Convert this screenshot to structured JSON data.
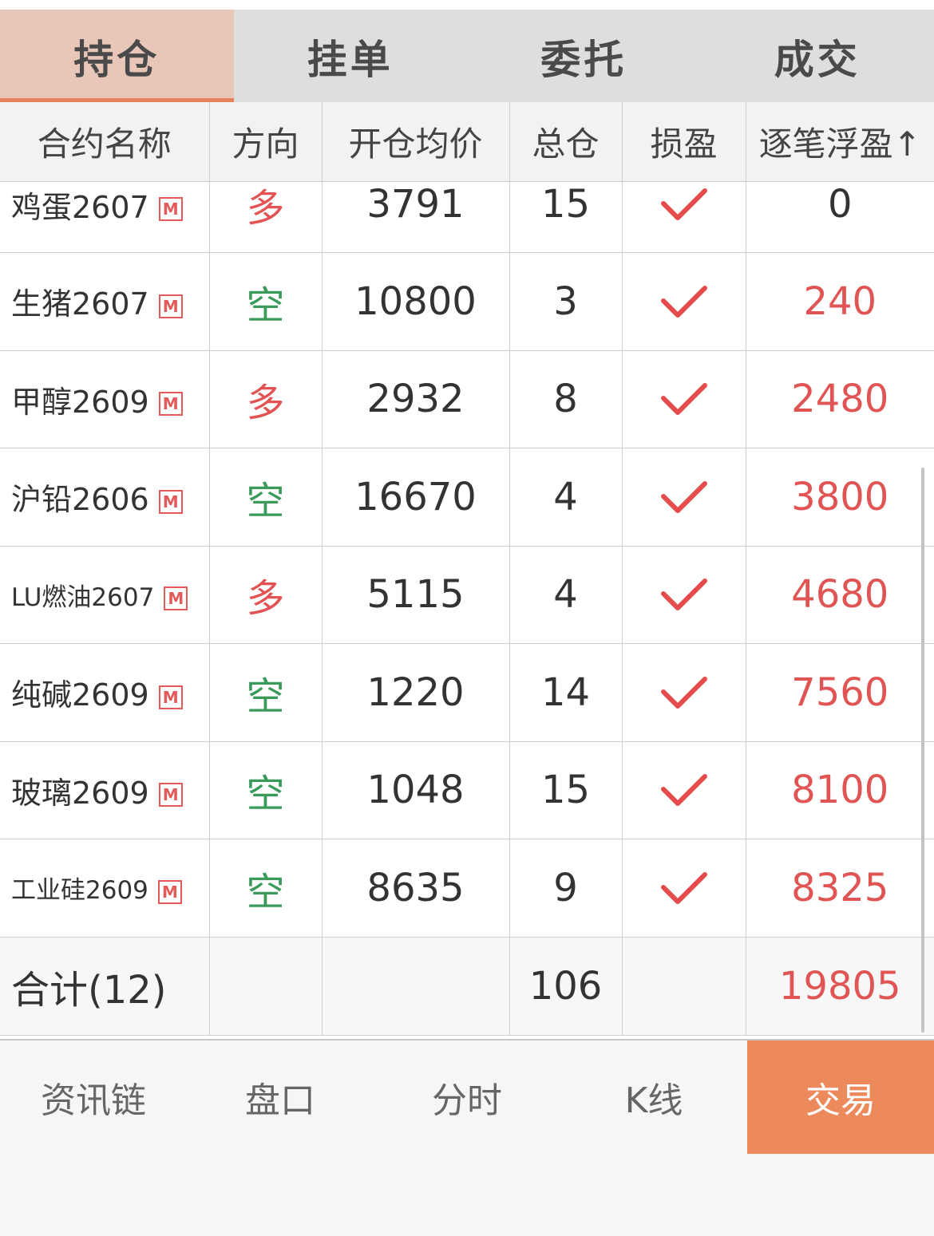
{
  "tabs": [
    {
      "label": "持仓",
      "active": true
    },
    {
      "label": "挂单",
      "active": false
    },
    {
      "label": "委托",
      "active": false
    },
    {
      "label": "成交",
      "active": false
    }
  ],
  "table": {
    "headers": [
      "合约名称",
      "方向",
      "开仓均价",
      "总仓",
      "损盈",
      "逐笔浮盈↑"
    ],
    "rows": [
      {
        "name": "鸡蛋2607",
        "badge": "M",
        "direction": "多",
        "avg_price": "3791",
        "qty": "15",
        "pnl": "0"
      },
      {
        "name": "生猪2607",
        "badge": "M",
        "direction": "空",
        "avg_price": "10800",
        "qty": "3",
        "pnl": "240"
      },
      {
        "name": "甲醇2609",
        "badge": "M",
        "direction": "多",
        "avg_price": "2932",
        "qty": "8",
        "pnl": "2480"
      },
      {
        "name": "沪铅2606",
        "badge": "M",
        "direction": "空",
        "avg_price": "16670",
        "qty": "4",
        "pnl": "3800"
      },
      {
        "name": "LU燃油2607",
        "badge": "M",
        "direction": "多",
        "avg_price": "5115",
        "qty": "4",
        "pnl": "4680"
      },
      {
        "name": "纯碱2609",
        "badge": "M",
        "direction": "空",
        "avg_price": "1220",
        "qty": "14",
        "pnl": "7560"
      },
      {
        "name": "玻璃2609",
        "badge": "M",
        "direction": "空",
        "avg_price": "1048",
        "qty": "15",
        "pnl": "8100"
      },
      {
        "name": "工业硅2609",
        "badge": "M",
        "direction": "空",
        "avg_price": "8635",
        "qty": "9",
        "pnl": "8325"
      }
    ],
    "total": {
      "label": "合计(12)",
      "qty": "106",
      "pnl": "19805"
    }
  },
  "bottom_nav": [
    "资讯链",
    "盘口",
    "分时",
    "K线",
    "交易"
  ],
  "colors": {
    "accent": "#ec8a5c",
    "long": "#e35353",
    "short": "#3a9a5a",
    "profit": "#e05454"
  },
  "icons": {
    "check": "check-icon",
    "badge": "m-badge-icon"
  }
}
